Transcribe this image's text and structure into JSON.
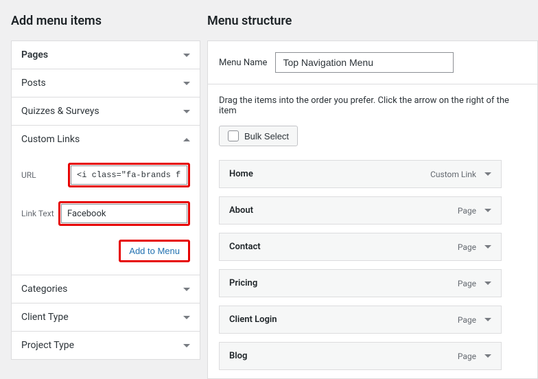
{
  "left": {
    "heading": "Add menu items",
    "accordions": {
      "pages": "Pages",
      "posts": "Posts",
      "quizzes": "Quizzes & Surveys",
      "custom_links": "Custom Links",
      "categories": "Categories",
      "client_type": "Client Type",
      "project_type": "Project Type"
    },
    "custom_links_form": {
      "url_label": "URL",
      "url_value": "<i class=\"fa-brands f",
      "link_text_label": "Link Text",
      "link_text_value": "Facebook",
      "add_button": "Add to Menu"
    }
  },
  "right": {
    "heading": "Menu structure",
    "menu_name_label": "Menu Name",
    "menu_name_value": "Top Navigation Menu",
    "instructions": "Drag the items into the order you prefer. Click the arrow on the right of the item",
    "bulk_select": "Bulk Select",
    "items": [
      {
        "title": "Home",
        "type": "Custom Link"
      },
      {
        "title": "About",
        "type": "Page"
      },
      {
        "title": "Contact",
        "type": "Page"
      },
      {
        "title": "Pricing",
        "type": "Page"
      },
      {
        "title": "Client Login",
        "type": "Page"
      },
      {
        "title": "Blog",
        "type": "Page"
      }
    ]
  }
}
